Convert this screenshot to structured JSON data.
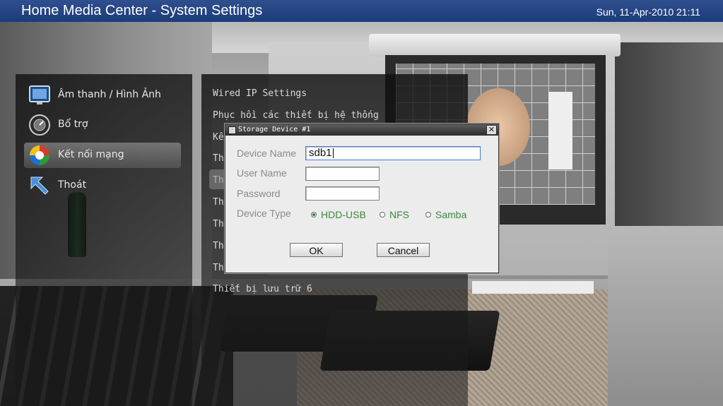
{
  "app": {
    "title": "Home Media Center - System Settings",
    "datetime": "Sun, 11-Apr-2010 21:11"
  },
  "menu": {
    "items": [
      {
        "label": "Âm thanh / Hình Ảnh",
        "icon": "monitor-icon",
        "selected": false
      },
      {
        "label": "Bổ trợ",
        "icon": "dial-icon",
        "selected": false
      },
      {
        "label": "Kết nối mạng",
        "icon": "network-icon",
        "selected": true
      },
      {
        "label": "Thoát",
        "icon": "back-arrow-icon",
        "selected": false
      }
    ]
  },
  "settings_list": {
    "items": [
      "Wired IP Settings",
      "Phục hồi các thiết bị hệ thống",
      "Kế",
      "Th",
      "Th",
      "Th",
      "Th",
      "Th",
      "Th",
      "Thiết bị lưu trữ 6"
    ]
  },
  "dialog": {
    "title": "Storage Device #1",
    "fields": {
      "device_name": {
        "label": "Device Name",
        "value": "sdb1"
      },
      "user_name": {
        "label": "User Name",
        "value": ""
      },
      "password": {
        "label": "Password",
        "value": ""
      }
    },
    "device_type": {
      "label": "Device Type",
      "options": [
        "HDD-USB",
        "NFS",
        "Samba"
      ],
      "selected": "HDD-USB"
    },
    "ok_label": "OK",
    "cancel_label": "Cancel",
    "close_glyph": "✕"
  },
  "colors": {
    "titlebar": "#1b3b79",
    "radio_text": "#3a8a3a",
    "dialog_bg": "#ececec"
  }
}
